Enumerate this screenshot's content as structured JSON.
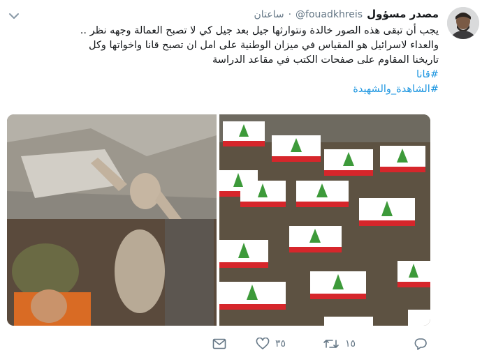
{
  "tweet": {
    "display_name": "مصدر مسؤول",
    "handle": "@fouadkhreis",
    "separator": "·",
    "time": "ساعتان",
    "lines": [
      "يجب أن تبقى هذه الصور خالدة ونتوارثها جيل بعد جيل كي لا تصبح العمالة وجهه نظر ..",
      "والعداء لاسرائيل هو المقياس في ميزان الوطنية على امل ان تصبح قانا واخواتها وكل",
      "تاريخنا المقاوم على صفحات الكتب في مقاعد الدراسة"
    ],
    "hashtags": [
      "#قانا",
      "#الشاهدة_والشهيدة"
    ]
  },
  "actions": {
    "reply_count": "",
    "retweet_count": "١٥",
    "like_count": "٣٥",
    "dm_count": ""
  },
  "colors": {
    "text": "#14171a",
    "secondary": "#657786",
    "link": "#1b95e0"
  },
  "icons": [
    "chevron-down-icon",
    "reply-icon",
    "retweet-icon",
    "like-icon",
    "message-icon"
  ]
}
